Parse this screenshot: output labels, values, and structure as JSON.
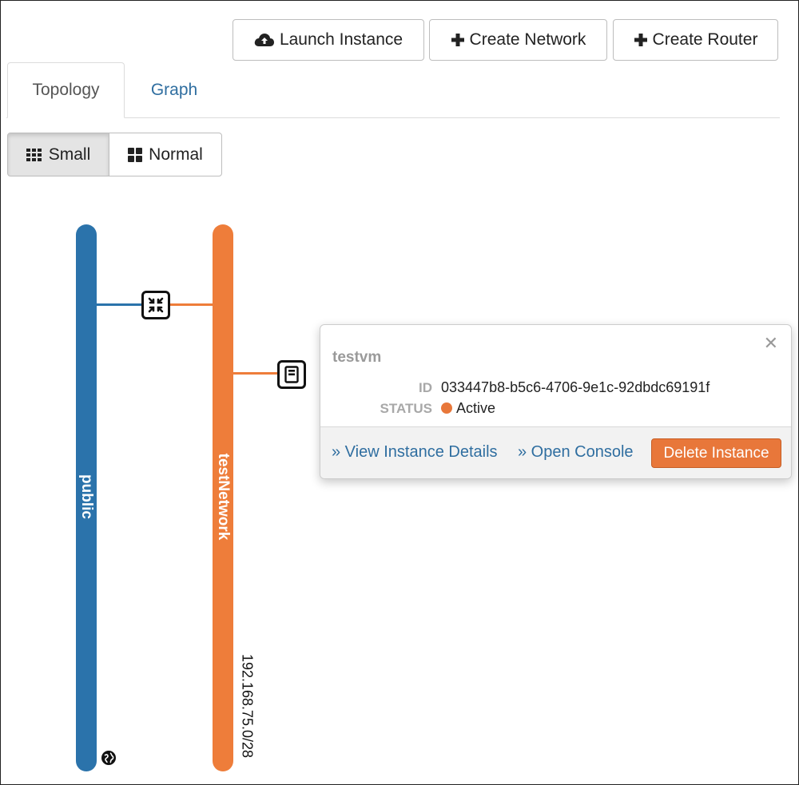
{
  "toolbar": {
    "launch_instance": "Launch Instance",
    "create_network": "Create Network",
    "create_router": "Create Router"
  },
  "tabs": [
    {
      "label": "Topology",
      "active": true
    },
    {
      "label": "Graph",
      "active": false
    }
  ],
  "view_toggle": {
    "small": "Small",
    "normal": "Normal",
    "selected": "Small"
  },
  "topology": {
    "networks": [
      {
        "name": "public",
        "color": "#2b73ab",
        "icon": "globe-icon"
      },
      {
        "name": "testNetwork",
        "color": "#ee7d3a",
        "cidr": "192.168.75.0/28"
      }
    ],
    "router_icon": "router-icon",
    "instance_icon": "server-icon"
  },
  "popup": {
    "instance_name": "testvm",
    "id_label": "ID",
    "id_value": "033447b8-b5c6-4706-9e1c-92dbdc69191f",
    "status_label": "STATUS",
    "status_value": "Active",
    "status_color": "#e8773a",
    "view_details": "» View Instance Details",
    "open_console": "» Open Console",
    "delete_instance": "Delete Instance",
    "close_symbol": "✕"
  }
}
